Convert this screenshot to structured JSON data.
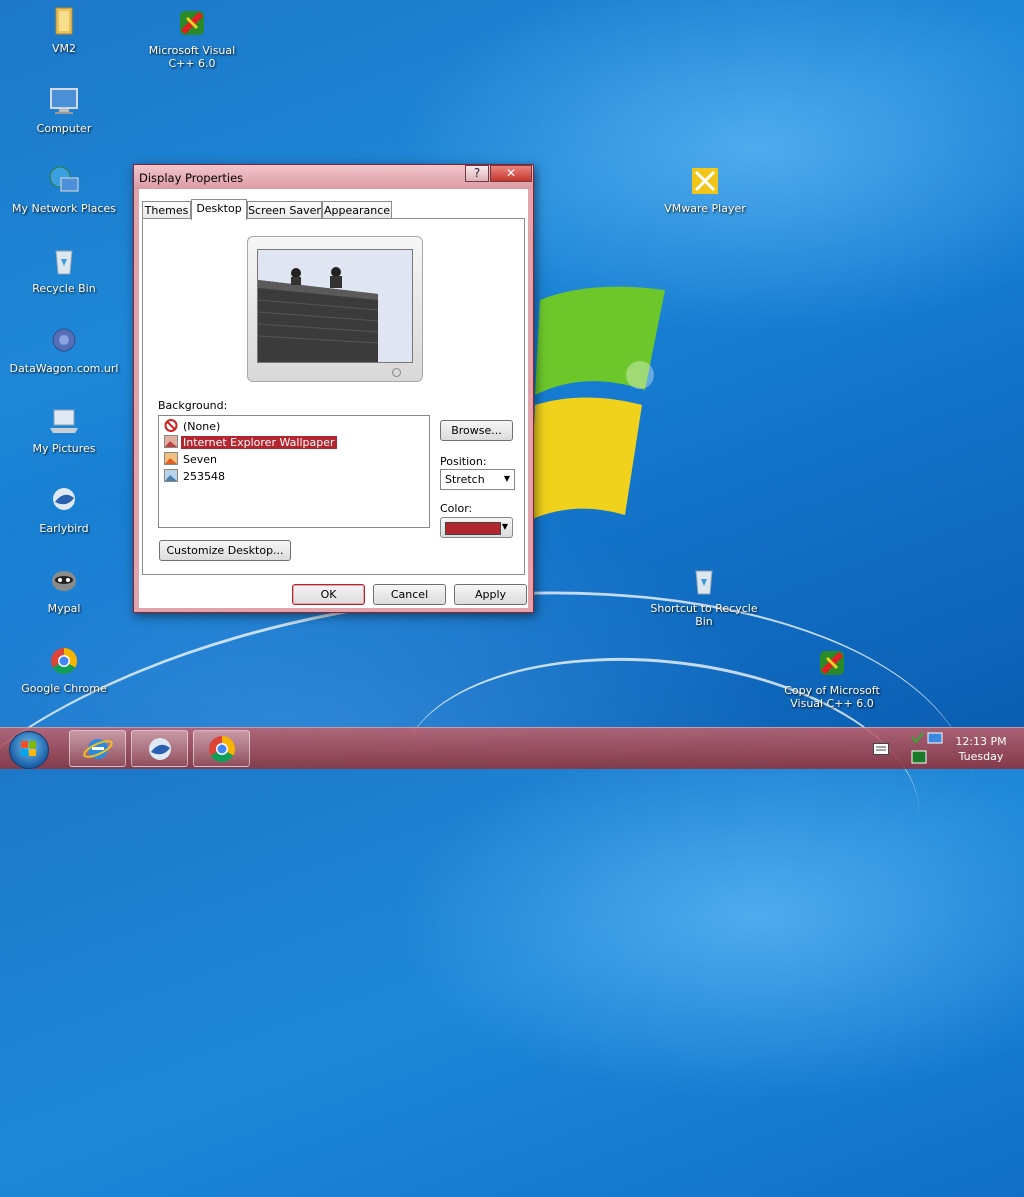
{
  "desktop": {
    "icons": [
      {
        "label": "VM2",
        "icon": "folder-icon"
      },
      {
        "label": "Microsoft Visual C++ 6.0",
        "icon": "visual-cpp-icon"
      },
      {
        "label": "Computer",
        "icon": "computer-icon"
      },
      {
        "label": "My Network Places",
        "icon": "network-icon"
      },
      {
        "label": "Recycle Bin",
        "icon": "recycle-bin-icon"
      },
      {
        "label": "DataWagon.com.url",
        "icon": "url-shortcut-icon"
      },
      {
        "label": "My Pictures",
        "icon": "pictures-icon"
      },
      {
        "label": "Earlybird",
        "icon": "earlybird-icon"
      },
      {
        "label": "Mypal",
        "icon": "mypal-icon"
      },
      {
        "label": "Google Chrome",
        "icon": "chrome-icon"
      },
      {
        "label": "VMware Player",
        "icon": "vmware-icon"
      },
      {
        "label": "Shortcut to Recycle Bin",
        "icon": "recycle-bin-icon"
      },
      {
        "label": "Copy of Microsoft Visual C++ 6.0",
        "icon": "visual-cpp-icon"
      }
    ]
  },
  "dialog": {
    "title": "Display Properties",
    "help_glyph": "?",
    "close_glyph": "✕",
    "tabs": [
      {
        "label": "Themes",
        "active": false
      },
      {
        "label": "Desktop",
        "active": true
      },
      {
        "label": "Screen Saver",
        "active": false
      },
      {
        "label": "Appearance",
        "active": false
      }
    ],
    "background_label": "Background:",
    "background_items": [
      {
        "label": "(None)",
        "icon": "none-icon",
        "selected": false
      },
      {
        "label": "Internet Explorer Wallpaper",
        "icon": "image-icon",
        "selected": true
      },
      {
        "label": "Seven",
        "icon": "image-icon",
        "selected": false
      },
      {
        "label": "253548",
        "icon": "image-icon",
        "selected": false
      }
    ],
    "browse_label": "Browse...",
    "position_label": "Position:",
    "position_value": "Stretch",
    "color_label": "Color:",
    "color_value": "#b3262f",
    "customize_label": "Customize Desktop...",
    "ok_label": "OK",
    "cancel_label": "Cancel",
    "apply_label": "Apply"
  },
  "taskbar": {
    "apps": [
      "internet-explorer-icon",
      "earlybird-icon",
      "chrome-icon"
    ],
    "clock_time": "12:13 PM",
    "clock_day": "Tuesday"
  }
}
